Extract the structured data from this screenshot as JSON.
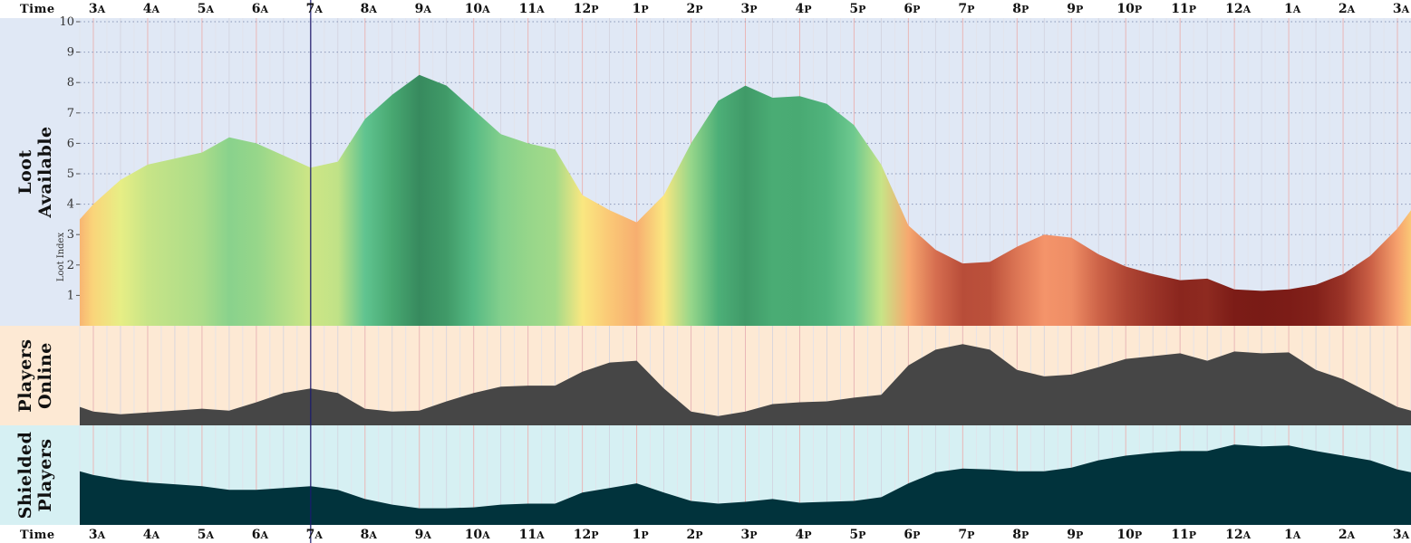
{
  "chart_data": {
    "type": "area",
    "time_axis": {
      "title": "Time",
      "tick_hours": [
        "3",
        "4",
        "5",
        "6",
        "7",
        "8",
        "9",
        "10",
        "11",
        "12",
        "1",
        "2",
        "3",
        "4",
        "5",
        "6",
        "7",
        "8",
        "9",
        "10",
        "11",
        "12",
        "1",
        "2",
        "3"
      ],
      "tick_suffix": [
        "A",
        "A",
        "A",
        "A",
        "A",
        "A",
        "A",
        "A",
        "A",
        "P",
        "P",
        "P",
        "P",
        "P",
        "P",
        "P",
        "P",
        "P",
        "P",
        "P",
        "P",
        "A",
        "A",
        "A",
        "A"
      ],
      "x_range": [
        2.75,
        27.25
      ],
      "current_time": 7.0
    },
    "panels": [
      {
        "id": "loot",
        "title_lines": [
          "Loot",
          "Available"
        ],
        "ylabel": "Loot Index",
        "ylim": [
          0,
          10
        ],
        "yticks": [
          1,
          2,
          3,
          4,
          5,
          6,
          7,
          8,
          9,
          10
        ],
        "background": "#e0e8f5",
        "gradient_by_value": true,
        "x": [
          2.75,
          3.0,
          3.5,
          4.0,
          4.5,
          5.0,
          5.5,
          6.0,
          6.5,
          7.0,
          7.5,
          8.0,
          8.5,
          9.0,
          9.5,
          10.0,
          10.5,
          11.0,
          11.5,
          12.0,
          12.5,
          13.0,
          13.5,
          14.0,
          14.5,
          15.0,
          15.5,
          16.0,
          16.5,
          17.0,
          17.5,
          18.0,
          18.5,
          19.0,
          19.5,
          20.0,
          20.5,
          21.0,
          21.5,
          22.0,
          22.5,
          23.0,
          23.5,
          24.0,
          24.5,
          25.0,
          25.5,
          26.0,
          26.5,
          27.0,
          27.25
        ],
        "y": [
          3.5,
          4.0,
          4.8,
          5.3,
          5.5,
          5.7,
          6.2,
          6.0,
          5.6,
          5.2,
          5.4,
          6.8,
          7.6,
          8.25,
          7.9,
          7.1,
          6.3,
          6.0,
          5.8,
          4.3,
          3.8,
          3.4,
          4.3,
          6.0,
          7.4,
          7.9,
          7.5,
          7.55,
          7.3,
          6.6,
          5.3,
          3.3,
          2.5,
          2.05,
          2.1,
          2.6,
          3.0,
          2.9,
          2.35,
          1.95,
          1.7,
          1.5,
          1.55,
          1.2,
          1.15,
          1.2,
          1.35,
          1.7,
          2.3,
          3.2,
          3.8
        ]
      },
      {
        "id": "players",
        "title_lines": [
          "Players",
          "Online"
        ],
        "ylim": [
          0,
          10
        ],
        "background": "#fde9d4",
        "fill": "#464646",
        "x": [
          2.75,
          3.0,
          3.5,
          4.0,
          4.5,
          5.0,
          5.5,
          6.0,
          6.5,
          7.0,
          7.5,
          8.0,
          8.5,
          9.0,
          9.5,
          10.0,
          10.5,
          11.0,
          11.5,
          12.0,
          12.5,
          13.0,
          13.5,
          14.0,
          14.5,
          15.0,
          15.5,
          16.0,
          16.5,
          17.0,
          17.5,
          18.0,
          18.5,
          19.0,
          19.5,
          20.0,
          20.5,
          21.0,
          21.5,
          22.0,
          22.5,
          23.0,
          23.5,
          24.0,
          24.5,
          25.0,
          25.5,
          26.0,
          26.5,
          27.0,
          27.25
        ],
        "y": [
          2.0,
          1.5,
          1.2,
          1.4,
          1.6,
          1.8,
          1.6,
          2.5,
          3.5,
          4.0,
          3.5,
          1.8,
          1.5,
          1.6,
          2.6,
          3.5,
          4.2,
          4.3,
          4.3,
          5.8,
          6.8,
          7.0,
          4.0,
          1.5,
          1.0,
          1.5,
          2.3,
          2.5,
          2.6,
          3.0,
          3.3,
          6.5,
          8.2,
          8.8,
          8.2,
          6.0,
          5.3,
          5.5,
          6.3,
          7.2,
          7.5,
          7.8,
          7.0,
          8.0,
          7.8,
          7.9,
          6.0,
          5.0,
          3.5,
          2.0,
          1.6
        ]
      },
      {
        "id": "shielded",
        "title_lines": [
          "Shielded",
          "Players"
        ],
        "ylim": [
          0,
          10
        ],
        "background": "#d6f0f3",
        "fill": "#01333c",
        "x": [
          2.75,
          3.0,
          3.5,
          4.0,
          4.5,
          5.0,
          5.5,
          6.0,
          6.5,
          7.0,
          7.5,
          8.0,
          8.5,
          9.0,
          9.5,
          10.0,
          10.5,
          11.0,
          11.5,
          12.0,
          12.5,
          13.0,
          13.5,
          14.0,
          14.5,
          15.0,
          15.5,
          16.0,
          16.5,
          17.0,
          17.5,
          18.0,
          18.5,
          19.0,
          19.5,
          20.0,
          20.5,
          21.0,
          21.5,
          22.0,
          22.5,
          23.0,
          23.5,
          24.0,
          24.5,
          25.0,
          25.5,
          26.0,
          26.5,
          27.0,
          27.25
        ],
        "y": [
          5.8,
          5.4,
          4.9,
          4.6,
          4.4,
          4.2,
          3.8,
          3.8,
          4.0,
          4.2,
          3.8,
          2.8,
          2.2,
          1.8,
          1.8,
          1.9,
          2.2,
          2.3,
          2.3,
          3.5,
          4.0,
          4.5,
          3.5,
          2.6,
          2.3,
          2.5,
          2.8,
          2.4,
          2.5,
          2.6,
          3.0,
          4.5,
          5.7,
          6.1,
          6.0,
          5.8,
          5.8,
          6.2,
          7.0,
          7.5,
          7.8,
          8.0,
          8.0,
          8.7,
          8.5,
          8.6,
          8.0,
          7.5,
          7.0,
          6.0,
          5.7
        ]
      }
    ]
  }
}
